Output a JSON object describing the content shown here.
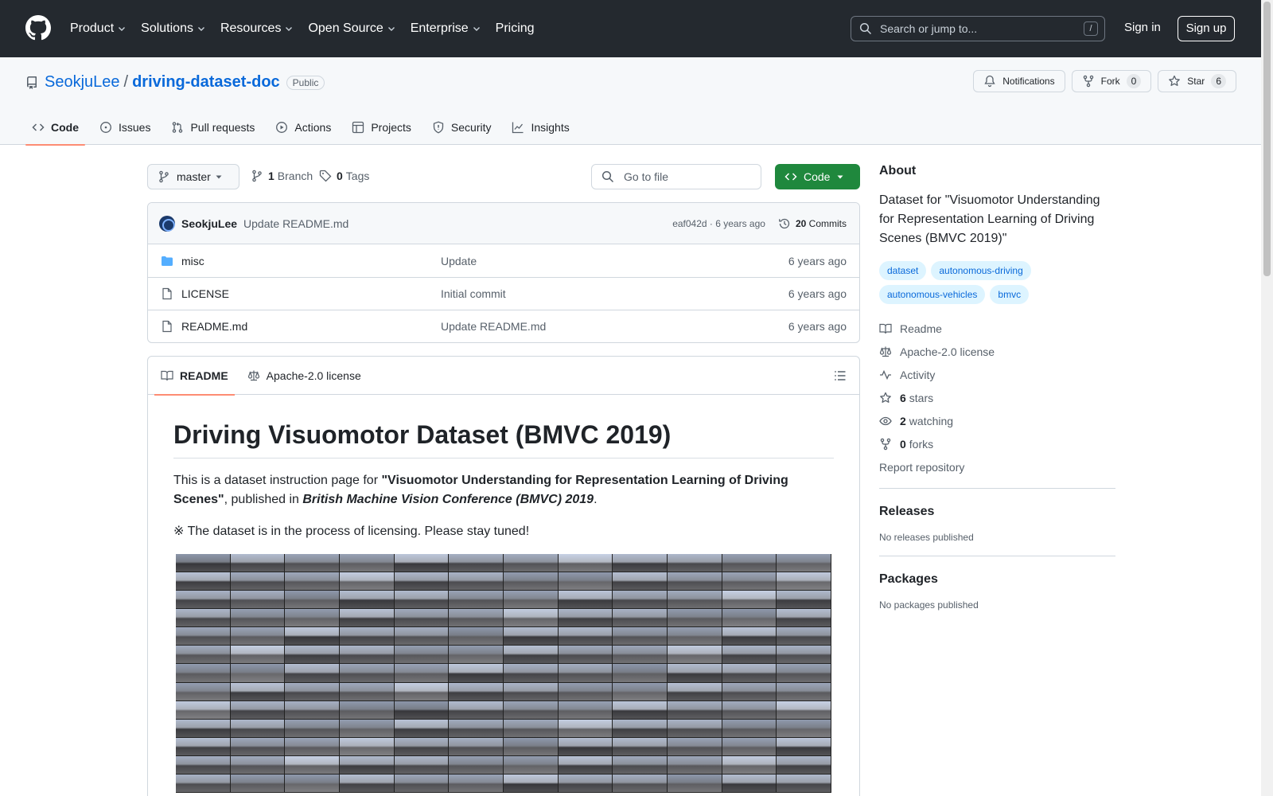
{
  "header": {
    "nav": [
      "Product",
      "Solutions",
      "Resources",
      "Open Source",
      "Enterprise",
      "Pricing"
    ],
    "search_placeholder": "Search or jump to...",
    "search_key": "/",
    "sign_in": "Sign in",
    "sign_up": "Sign up"
  },
  "repo": {
    "owner": "SeokjuLee",
    "separator": "/",
    "name": "driving-dataset-doc",
    "visibility": "Public",
    "notifications": "Notifications",
    "fork_label": "Fork",
    "fork_count": "0",
    "star_label": "Star",
    "star_count": "6",
    "tabs": [
      "Code",
      "Issues",
      "Pull requests",
      "Actions",
      "Projects",
      "Security",
      "Insights"
    ]
  },
  "toolbar": {
    "branch": "master",
    "branch_count": "1",
    "branch_label": "Branch",
    "tag_count": "0",
    "tag_label": "Tags",
    "goto_placeholder": "Go to file",
    "code_button": "Code"
  },
  "latest_commit": {
    "author": "SeokjuLee",
    "message": "Update README.md",
    "hash_time": "eaf042d · 6 years ago",
    "commits_count": "20",
    "commits_label": "Commits"
  },
  "files": [
    {
      "name": "misc",
      "type": "folder",
      "message": "Update",
      "age": "6 years ago"
    },
    {
      "name": "LICENSE",
      "type": "file",
      "message": "Initial commit",
      "age": "6 years ago"
    },
    {
      "name": "README.md",
      "type": "file",
      "message": "Update README.md",
      "age": "6 years ago"
    }
  ],
  "readme": {
    "tab_readme": "README",
    "tab_license": "Apache-2.0 license",
    "title": "Driving Visuomotor Dataset (BMVC 2019)",
    "p1_pre": "This is a dataset instruction page for ",
    "p1_bold": "\"Visuomotor Understanding for Representation Learning of Driving Scenes\"",
    "p1_mid": ", published in ",
    "p1_em": "British Machine Vision Conference (BMVC) 2019",
    "p1_end": ".",
    "p2": "※ The dataset is in the process of licensing. Please stay tuned!"
  },
  "sidebar": {
    "about_title": "About",
    "description": "Dataset for \"Visuomotor Understanding for Representation Learning of Driving Scenes (BMVC 2019)\"",
    "topics": [
      "dataset",
      "autonomous-driving",
      "autonomous-vehicles",
      "bmvc"
    ],
    "readme_link": "Readme",
    "license_link": "Apache-2.0 license",
    "activity_link": "Activity",
    "stars_count": "6",
    "stars_label": "stars",
    "watching_count": "2",
    "watching_label": "watching",
    "forks_count": "0",
    "forks_label": "forks",
    "report": "Report repository",
    "releases_title": "Releases",
    "releases_note": "No releases published",
    "packages_title": "Packages",
    "packages_note": "No packages published"
  },
  "colors": {
    "header_bg": "#24292f",
    "link": "#0969da",
    "green_button": "#1f883d",
    "active_tab_underline": "#fd8c73"
  }
}
